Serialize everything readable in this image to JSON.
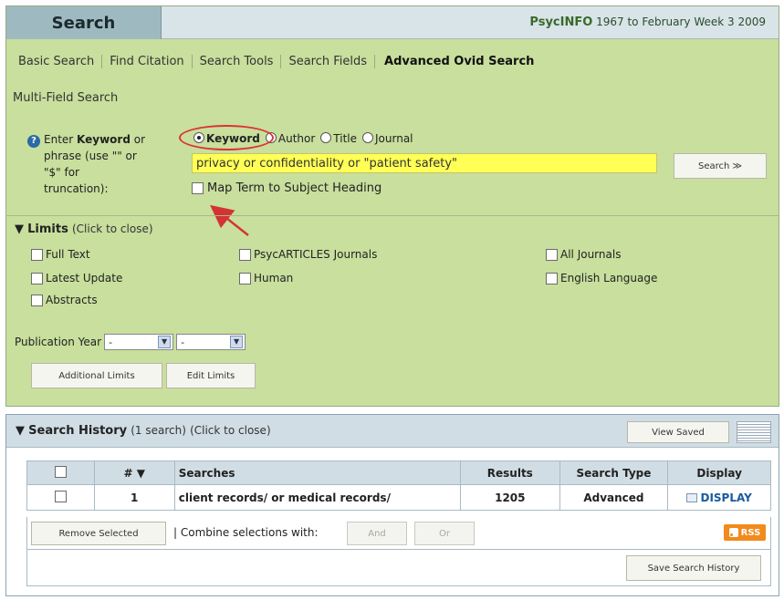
{
  "header": {
    "tab_label": "Search",
    "database": "PsycINFO",
    "coverage": "1967 to February Week 3 2009"
  },
  "search_tabs": [
    "Basic Search",
    "Find Citation",
    "Search Tools",
    "Search Fields",
    "Advanced Ovid Search"
  ],
  "multi_field": "Multi-Field Search",
  "help": {
    "line1_pre": "Enter",
    "line1_bold": "Keyword",
    "line1_post": "or",
    "line2": "phrase (use \"\" or",
    "line3": "\"$\" for",
    "line4": "truncation):"
  },
  "search_by": {
    "options": [
      "Keyword",
      "Author",
      "Title",
      "Journal"
    ],
    "selected": "Keyword"
  },
  "search_input": {
    "value": "privacy or confidentiality or \"patient safety\""
  },
  "search_button": "Search ≫",
  "map_term_label": "Map Term to Subject Heading",
  "limits": {
    "title": "Limits",
    "toggle": "(Click to close)",
    "items": [
      "Full Text",
      "Latest Update",
      "Abstracts",
      "PsycARTICLES Journals",
      "Human",
      "All Journals",
      "English Language"
    ],
    "pub_year_label": "Publication Year",
    "pub_year_from": "-",
    "pub_year_to": "-",
    "additional_button": "Additional Limits",
    "edit_button": "Edit Limits"
  },
  "history": {
    "title": "Search History",
    "count": "(1 search)",
    "toggle": "(Click to close)",
    "view_saved": "View Saved",
    "columns": [
      "#",
      "Searches",
      "Results",
      "Search Type",
      "Display"
    ],
    "rows": [
      {
        "num": "1",
        "search": "client records/ or medical records/",
        "results": "1205",
        "type": "Advanced",
        "display": "DISPLAY"
      }
    ],
    "remove_selected": "Remove Selected",
    "combine_label": "| Combine selections with:",
    "and_button": "And",
    "or_button": "Or",
    "rss": "RSS",
    "save_history": "Save Search History"
  },
  "colors": {
    "panel_green": "#c8df9d",
    "input_yellow": "#ffff55",
    "annotation_red": "#d33333",
    "rss_orange": "#f28a1c"
  }
}
